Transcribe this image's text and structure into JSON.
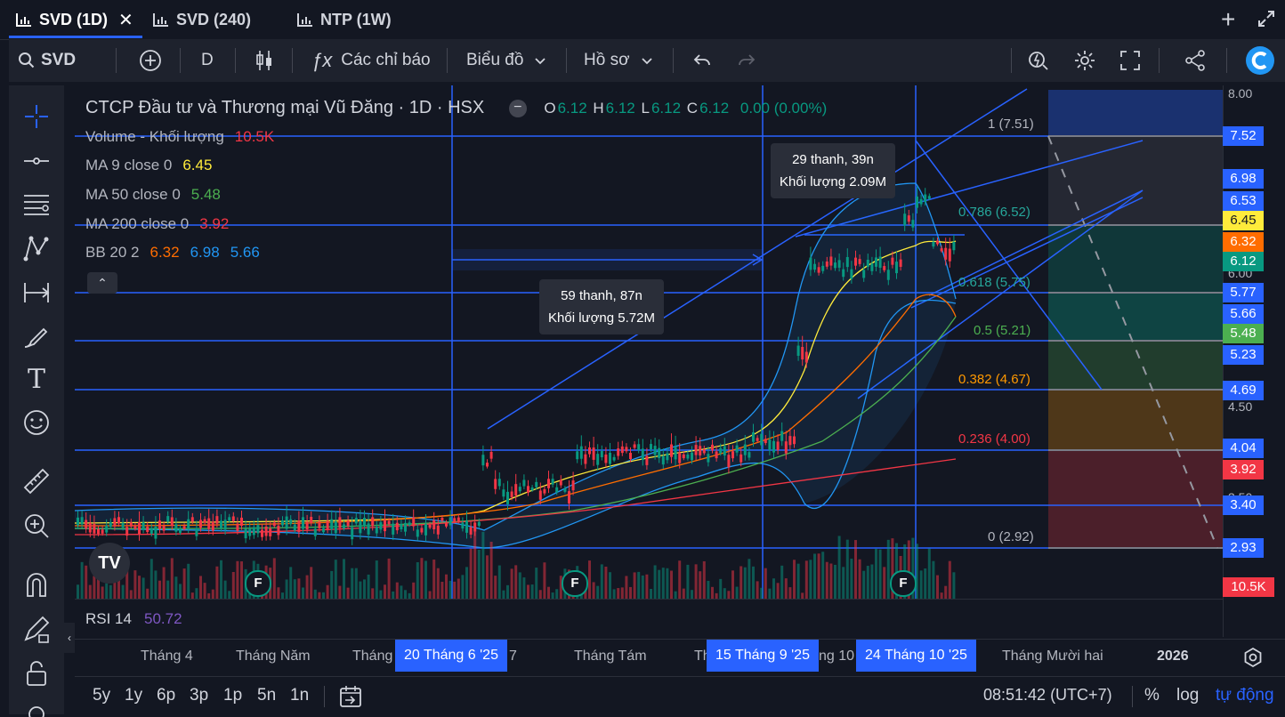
{
  "tabs": [
    {
      "label": "SVD (1D)",
      "active": true
    },
    {
      "label": "SVD (240)",
      "active": false
    },
    {
      "label": "NTP (1W)",
      "active": false
    }
  ],
  "toolbar": {
    "symbol": "SVD",
    "interval": "D",
    "indicators": "Các chỉ báo",
    "chart_menu": "Biểu đồ",
    "profile_menu": "Hồ sơ"
  },
  "legend": {
    "title": "CTCP Đầu tư và Thương mại Vũ Đăng · 1D · HSX",
    "ohlc": {
      "o_label": "O",
      "o": "6.12",
      "h_label": "H",
      "h": "6.12",
      "l_label": "L",
      "l": "6.12",
      "c_label": "C",
      "c": "6.12",
      "change": "0.00 (0.00%)"
    },
    "indicators": [
      {
        "name": "Volume - Khối lượng",
        "values": [
          "10.5K"
        ],
        "colors": [
          "#f23645"
        ]
      },
      {
        "name": "MA 9 close 0",
        "values": [
          "6.45"
        ],
        "colors": [
          "#ffeb3b"
        ]
      },
      {
        "name": "MA 50 close 0",
        "values": [
          "5.48"
        ],
        "colors": [
          "#4caf50"
        ]
      },
      {
        "name": "MA 200 close 0",
        "values": [
          "3.92"
        ],
        "colors": [
          "#f23645"
        ]
      },
      {
        "name": "BB 20 2",
        "values": [
          "6.32",
          "6.98",
          "5.66"
        ],
        "colors": [
          "#ff6d00",
          "#2196f3",
          "#2196f3"
        ]
      }
    ]
  },
  "tooltips": [
    {
      "line1": "29 thanh, 39n",
      "line2": "Khối lượng 2.09M"
    },
    {
      "line1": "59 thanh, 87n",
      "line2": "Khối lượng 5.72M"
    }
  ],
  "fib_levels": [
    {
      "label": "1 (7.51)",
      "color": "#b2b5be"
    },
    {
      "label": "0.786 (6.52)",
      "color": "#26a69a"
    },
    {
      "label": "0.618 (5.75)",
      "color": "#26a69a"
    },
    {
      "label": "0.5 (5.21)",
      "color": "#4caf50"
    },
    {
      "label": "0.382 (4.67)",
      "color": "#ff9800"
    },
    {
      "label": "0.236 (4.00)",
      "color": "#f23645"
    },
    {
      "label": "0 (2.92)",
      "color": "#b2b5be"
    }
  ],
  "price_ticks": [
    "8.00",
    "6.00",
    "4.50",
    "3.50",
    "5.00"
  ],
  "price_labels": [
    {
      "value": "7.52",
      "bg": "#2962ff"
    },
    {
      "value": "6.98",
      "bg": "#2962ff"
    },
    {
      "value": "6.53",
      "bg": "#2962ff"
    },
    {
      "value": "6.45",
      "bg": "#ffeb3b"
    },
    {
      "value": "6.32",
      "bg": "#ff6d00"
    },
    {
      "value": "6.12",
      "bg": "#089981"
    },
    {
      "value": "5.77",
      "bg": "#2962ff"
    },
    {
      "value": "5.66",
      "bg": "#2962ff"
    },
    {
      "value": "5.48",
      "bg": "#4caf50"
    },
    {
      "value": "5.23",
      "bg": "#2962ff"
    },
    {
      "value": "4.69",
      "bg": "#2962ff"
    },
    {
      "value": "4.04",
      "bg": "#2962ff"
    },
    {
      "value": "3.92",
      "bg": "#f23645"
    },
    {
      "value": "3.40",
      "bg": "#2962ff"
    },
    {
      "value": "2.93",
      "bg": "#2962ff"
    },
    {
      "value": "10.5K",
      "bg": "#f23645"
    }
  ],
  "rsi": {
    "name": "RSI 14",
    "value": "50.72"
  },
  "time_axis": {
    "labels": [
      "Tháng 4",
      "Tháng Năm",
      "Tháng",
      "7",
      "Tháng Tám",
      "Th",
      "ng 10",
      "Tháng Mười hai",
      "2026"
    ],
    "badges": [
      "20 Tháng 6 '25",
      "15 Tháng 9 '25",
      "24 Tháng 10 '25"
    ]
  },
  "bottom": {
    "ranges": [
      "5y",
      "1y",
      "6p",
      "3p",
      "1p",
      "5n",
      "1n"
    ],
    "clock": "08:51:42 (UTC+7)",
    "percent": "%",
    "log": "log",
    "auto": "tự động"
  },
  "earnings_marker": "F",
  "colors": {
    "up": "#089981",
    "down": "#f23645",
    "accent": "#2962ff"
  }
}
